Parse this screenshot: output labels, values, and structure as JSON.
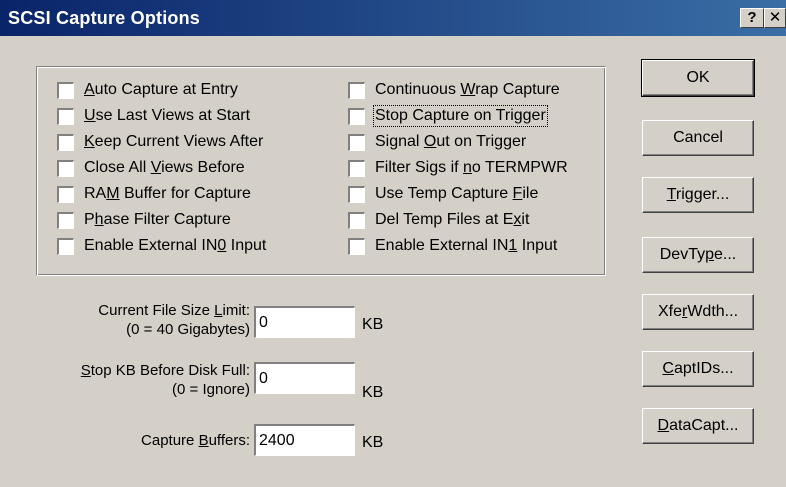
{
  "window": {
    "title": "SCSI Capture Options",
    "help_glyph": "?",
    "close_glyph": "✕"
  },
  "options": {
    "left": [
      {
        "pre": "",
        "key": "A",
        "post": "uto Capture at Entry"
      },
      {
        "pre": "",
        "key": "U",
        "post": "se Last Views at Start"
      },
      {
        "pre": "",
        "key": "K",
        "post": "eep Current Views After"
      },
      {
        "pre": "Close All ",
        "key": "V",
        "post": "iews Before"
      },
      {
        "pre": "RA",
        "key": "M",
        "post": " Buffer for Capture"
      },
      {
        "pre": "P",
        "key": "h",
        "post": "ase Filter Capture"
      },
      {
        "pre": "Enable External IN",
        "key": "0",
        "post": " Input"
      }
    ],
    "right": [
      {
        "pre": "Continuous ",
        "key": "W",
        "post": "rap Capture"
      },
      {
        "pre": "Stop Capture on Tri",
        "key": "g",
        "post": "ger"
      },
      {
        "pre": "Signal ",
        "key": "O",
        "post": "ut on Trigger"
      },
      {
        "pre": "Filter Sigs if ",
        "key": "n",
        "post": "o TERMPWR"
      },
      {
        "pre": "Use Temp Capture ",
        "key": "F",
        "post": "ile"
      },
      {
        "pre": "Del Temp Files at E",
        "key": "x",
        "post": "it"
      },
      {
        "pre": "Enable External IN",
        "key": "1",
        "post": " Input"
      }
    ]
  },
  "fields": {
    "file_size": {
      "label1_pre": "Current File Size ",
      "label1_key": "L",
      "label1_post": "imit:",
      "label2": "(0 = 40 Gigabytes)",
      "value": "0",
      "unit": "KB"
    },
    "stop_kb": {
      "label1_pre": "",
      "label1_key": "S",
      "label1_post": "top KB Before Disk Full:",
      "label2": "(0 = Ignore)",
      "value": "0",
      "unit": "KB"
    },
    "buffers": {
      "label1_pre": "Capture ",
      "label1_key": "B",
      "label1_post": "uffers:",
      "value": "2400",
      "unit": "KB"
    }
  },
  "buttons": {
    "ok": {
      "pre": "OK",
      "key": "",
      "post": ""
    },
    "cancel": {
      "pre": "Cancel",
      "key": "",
      "post": ""
    },
    "trigger": {
      "pre": "",
      "key": "T",
      "post": "rigger..."
    },
    "devtype": {
      "pre": "DevTy",
      "key": "p",
      "post": "e..."
    },
    "xferwdth": {
      "pre": "Xfe",
      "key": "r",
      "post": "Wdth..."
    },
    "captids": {
      "pre": "",
      "key": "C",
      "post": "aptIDs..."
    },
    "datacapt": {
      "pre": "",
      "key": "D",
      "post": "ataCapt..."
    }
  }
}
